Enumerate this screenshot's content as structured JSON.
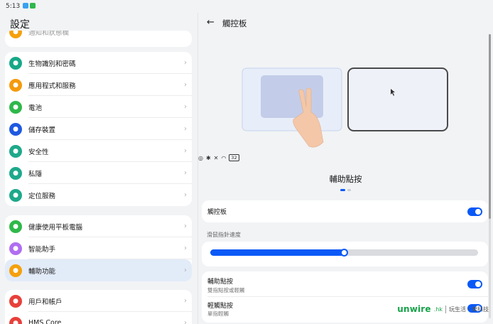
{
  "status_bar": {
    "time": "5:13",
    "battery": "32"
  },
  "left": {
    "title": "設定",
    "top_partial_label": "通知和狀態欄",
    "group1": [
      {
        "label": "生物識別和密碼",
        "icon": "fingerprint-icon",
        "color": "#17a888"
      },
      {
        "label": "應用程式和服務",
        "icon": "apps-icon",
        "color": "#f59a0c"
      },
      {
        "label": "電池",
        "icon": "battery-icon",
        "color": "#2fb84a"
      },
      {
        "label": "儲存裝置",
        "icon": "storage-icon",
        "color": "#1f5ae0"
      },
      {
        "label": "安全性",
        "icon": "shield-icon",
        "color": "#1ea98a"
      },
      {
        "label": "私隱",
        "icon": "privacy-icon",
        "color": "#1ea98a"
      },
      {
        "label": "定位服務",
        "icon": "location-icon",
        "color": "#1ea98a"
      }
    ],
    "group2": [
      {
        "label": "健康使用平板電腦",
        "icon": "hourglass-icon",
        "color": "#2fb84a"
      },
      {
        "label": "智能助手",
        "icon": "assistant-icon",
        "color": "#b06ef0"
      },
      {
        "label": "輔助功能",
        "icon": "accessibility-icon",
        "color": "#f5a00c"
      }
    ],
    "group3": [
      {
        "label": "用戶和帳戶",
        "icon": "user-icon",
        "color": "#e8403a"
      },
      {
        "label": "HMS Core",
        "icon": "hms-icon",
        "color": "#e8403a"
      }
    ]
  },
  "right": {
    "title": "觸控板",
    "caption": "輔助點按",
    "touchpad_toggle": {
      "label": "觸控板",
      "on": true
    },
    "speed_label": "滑鼠指針速度",
    "speed_value": 0.5,
    "assist_click": {
      "label": "輔助點按",
      "sub": "雙指點按或輕觸",
      "on": true
    },
    "tap_click": {
      "label": "輕觸點按",
      "sub": "單指輕觸",
      "on": true
    }
  },
  "watermark": {
    "logo": "unwire",
    "hk": ".hk",
    "tag": "玩生活・樂科技"
  },
  "colors": {
    "accent": "#0a59f7",
    "active_row": "#e2ebf8"
  }
}
